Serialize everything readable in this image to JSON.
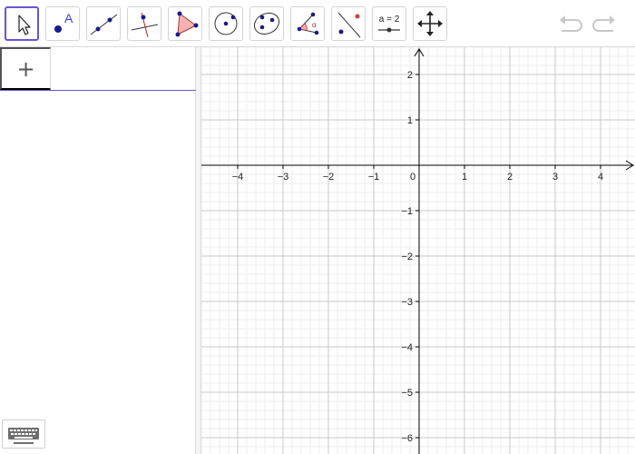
{
  "toolbar": {
    "tools": [
      {
        "icon": "move-arrow-icon",
        "active": true
      },
      {
        "icon": "point-icon",
        "label": "A"
      },
      {
        "icon": "line-icon"
      },
      {
        "icon": "perpendicular-line-icon"
      },
      {
        "icon": "polygon-icon"
      },
      {
        "icon": "circle-icon"
      },
      {
        "icon": "ellipse-icon"
      },
      {
        "icon": "angle-icon",
        "label": "α"
      },
      {
        "icon": "reflect-icon"
      },
      {
        "icon": "slider-icon",
        "label": "a = 2"
      },
      {
        "icon": "move-graphics-view-icon"
      }
    ],
    "undo_icon": "undo-icon",
    "redo_icon": "redo-icon"
  },
  "algebra": {
    "plus_label": "+",
    "keyboard_icon": "keyboard-icon"
  },
  "graphics": {
    "x_ticks": [
      "−4",
      "−3",
      "−2",
      "−1",
      "0",
      "1",
      "2",
      "3",
      "4"
    ],
    "y_ticks": [
      "2",
      "1",
      "−1",
      "−2",
      "−3",
      "−4",
      "−5",
      "−6"
    ],
    "grid": true,
    "colors": {
      "accent": "#6557d2",
      "grid": "#c8c8c8",
      "axis": "#000000"
    }
  }
}
